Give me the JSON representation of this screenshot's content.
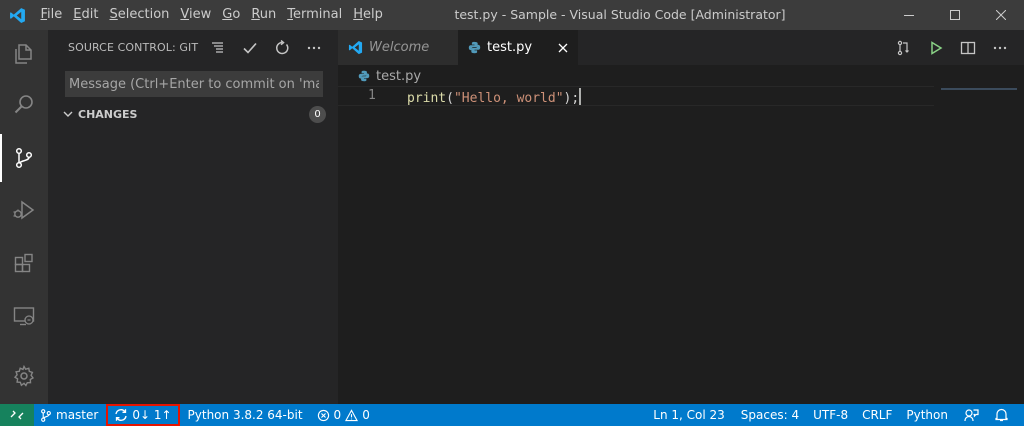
{
  "window": {
    "title": "test.py - Sample - Visual Studio Code [Administrator]"
  },
  "menu": {
    "items": [
      {
        "mnemonic": "F",
        "rest": "ile"
      },
      {
        "mnemonic": "E",
        "rest": "dit"
      },
      {
        "mnemonic": "S",
        "rest": "election"
      },
      {
        "mnemonic": "V",
        "rest": "iew"
      },
      {
        "mnemonic": "G",
        "rest": "o"
      },
      {
        "mnemonic": "R",
        "rest": "un"
      },
      {
        "mnemonic": "T",
        "rest": "erminal"
      },
      {
        "mnemonic": "H",
        "rest": "elp"
      }
    ]
  },
  "sidebar": {
    "title": "SOURCE CONTROL: GIT",
    "commit_placeholder": "Message (Ctrl+Enter to commit on 'master')",
    "changes_label": "CHANGES",
    "changes_count": "0"
  },
  "tabs": [
    {
      "label": "Welcome",
      "active": false
    },
    {
      "label": "test.py",
      "active": true
    }
  ],
  "breadcrumb": {
    "file": "test.py"
  },
  "editor": {
    "line_number": "1",
    "tokens": {
      "fn": "print",
      "open": "(",
      "str": "\"Hello, world\"",
      "close": ");"
    }
  },
  "statusbar": {
    "branch": "master",
    "sync": "0↓ 1↑",
    "interpreter": "Python 3.8.2 64-bit",
    "errors": "0",
    "warnings": "0",
    "position": "Ln 1, Col 23",
    "spaces": "Spaces: 4",
    "encoding": "UTF-8",
    "eol": "CRLF",
    "language": "Python"
  },
  "colors": {
    "accent": "#007acc",
    "remote": "#16825d",
    "highlight_box": "#e51400"
  }
}
